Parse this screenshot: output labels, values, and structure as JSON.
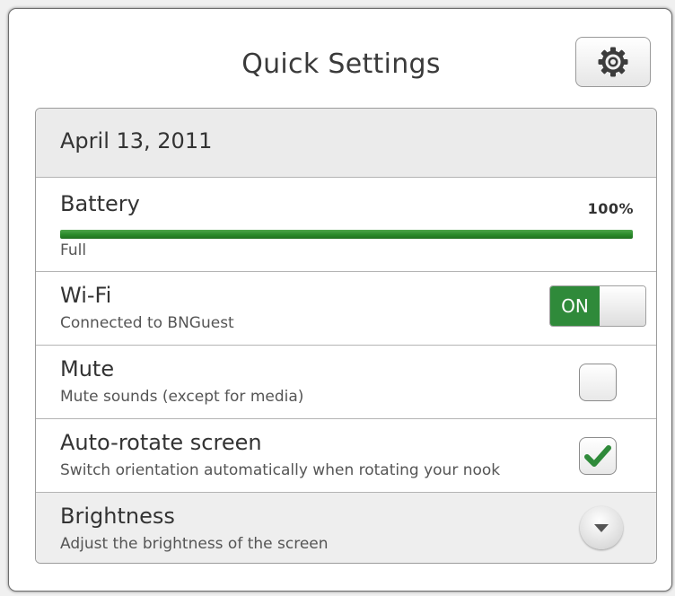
{
  "header": {
    "title": "Quick Settings",
    "settings_icon": "gear-icon"
  },
  "date": "April 13, 2011",
  "battery": {
    "title": "Battery",
    "percent_label": "100%",
    "level": 1.0,
    "status": "Full",
    "color": "#2a8a2a"
  },
  "wifi": {
    "title": "Wi-Fi",
    "subtitle": "Connected to BNGuest",
    "toggle_label": "ON",
    "enabled": true,
    "color": "#2f8a3a"
  },
  "mute": {
    "title": "Mute",
    "subtitle": "Mute sounds (except for media)",
    "checked": false
  },
  "rotate": {
    "title": "Auto-rotate screen",
    "subtitle": "Switch orientation automatically when rotating your nook",
    "checked": true,
    "check_color": "#2f8a3a"
  },
  "brightness": {
    "title": "Brightness",
    "subtitle": "Adjust the brightness of the screen",
    "expand_icon": "chevron-down-icon"
  }
}
